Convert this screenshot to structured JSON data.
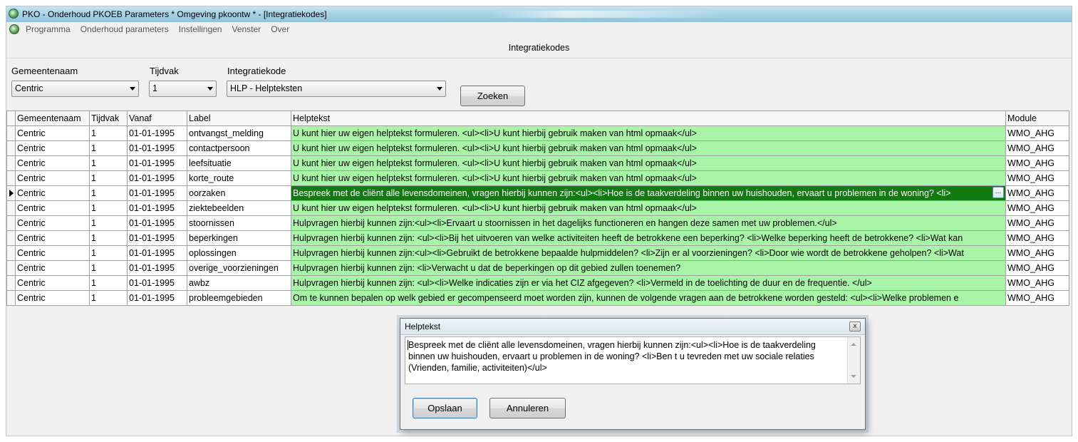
{
  "window": {
    "title": "PKO - Onderhoud PKOEB Parameters * Omgeving pkoontw * - [Integratiekodes]",
    "app_icon": "app-globe-icon"
  },
  "menu": {
    "items": [
      "Programma",
      "Onderhoud parameters",
      "Instellingen",
      "Venster",
      "Over"
    ]
  },
  "page": {
    "title": "Integratiekodes"
  },
  "filters": {
    "gemeente_label": "Gemeentenaam",
    "gemeente_value": "Centric",
    "tijdvak_label": "Tijdvak",
    "tijdvak_value": "1",
    "integratiekode_label": "Integratiekode",
    "integratiekode_value": "HLP - Helpteksten",
    "search_label": "Zoeken"
  },
  "grid": {
    "columns": [
      "Gemeentenaam",
      "Tijdvak",
      "Vanaf",
      "Label",
      "Helptekst",
      "Module"
    ],
    "selected_index": 4,
    "rows": [
      [
        "Centric",
        "1",
        "01-01-1995",
        "ontvangst_melding",
        "U kunt hier uw eigen helptekst formuleren. <ul><li>U kunt hierbij gebruik maken van html opmaak</ul>",
        "WMO_AHG"
      ],
      [
        "Centric",
        "1",
        "01-01-1995",
        "contactpersoon",
        "U kunt hier uw eigen helptekst formuleren. <ul><li>U kunt hierbij gebruik maken van html opmaak</ul>",
        "WMO_AHG"
      ],
      [
        "Centric",
        "1",
        "01-01-1995",
        "leefsituatie",
        "U kunt hier uw eigen helptekst formuleren. <ul><li>U kunt hierbij gebruik maken van html opmaak</ul>",
        "WMO_AHG"
      ],
      [
        "Centric",
        "1",
        "01-01-1995",
        "korte_route",
        "U kunt hier uw eigen helptekst formuleren. <ul><li>U kunt hierbij gebruik maken van html opmaak</ul>",
        "WMO_AHG"
      ],
      [
        "Centric",
        "1",
        "01-01-1995",
        "oorzaken",
        "Bespreek met de cliënt alle levensdomeinen, vragen hierbij kunnen zijn:<ul><li>Hoe is de taakverdeling binnen uw huishouden, ervaart u problemen in de woning? <li>",
        "WMO_AHG"
      ],
      [
        "Centric",
        "1",
        "01-01-1995",
        "ziektebeelden",
        "U kunt hier uw eigen helptekst formuleren. <ul><li>U kunt hierbij gebruik maken van html opmaak</ul>",
        "WMO_AHG"
      ],
      [
        "Centric",
        "1",
        "01-01-1995",
        "stoornissen",
        "Hulpvragen hierbij kunnen zijn:<ul><li>Ervaart u stoornissen in het dagelijks functioneren en hangen deze samen met uw problemen.</ul>",
        "WMO_AHG"
      ],
      [
        "Centric",
        "1",
        "01-01-1995",
        "beperkingen",
        "Hulpvragen hierbij kunnen zijn: <ul><li>Bij het uitvoeren van welke activiteiten heeft de betrokkene een beperking? <li>Welke beperking heeft de betrokkene? <li>Wat kan",
        "WMO_AHG"
      ],
      [
        "Centric",
        "1",
        "01-01-1995",
        "oplossingen",
        "Hulpvragen hierbij kunnen zijn:<ul><li>Gebruikt de betrokkene bepaalde hulpmiddelen? <li>Zijn er al voorzieningen? <li>Door wie wordt de betrokkene geholpen? <li>Wat",
        "WMO_AHG"
      ],
      [
        "Centric",
        "1",
        "01-01-1995",
        "overige_voorzieningen",
        "Hulpvragen hierbij kunnen zijn: <li>Verwacht u dat de beperkingen op dit gebied zullen toenemen?",
        "WMO_AHG"
      ],
      [
        "Centric",
        "1",
        "01-01-1995",
        "awbz",
        "Hulpvragen hierbij kunnen zijn: <ul><li>Welke indicaties zijn er via het CIZ afgegeven?  <li>Vermeld in de toelichting de duur en de frequentie. </ul>",
        "WMO_AHG"
      ],
      [
        "Centric",
        "1",
        "01-01-1995",
        "probleemgebieden",
        "Om te kunnen bepalen op welk gebied er gecompenseerd moet worden  zijn, kunnen de volgende vragen aan de betrokkene worden gesteld: <ul><li>Welke problemen e",
        "WMO_AHG"
      ]
    ]
  },
  "dialog": {
    "title": "Helptekst",
    "text": "Bespreek met de cliënt alle levensdomeinen, vragen hierbij kunnen zijn:<ul><li>Hoe is de taakverdeling binnen uw huishouden, ervaart u problemen in de woning? <li>Ben t u tevreden met uw sociale relaties (Vrienden, familie, activiteiten)</ul>",
    "save_label": "Opslaan",
    "cancel_label": "Annuleren",
    "close_glyph": "x"
  },
  "colors": {
    "help_cell_bg": "#a8f5a8",
    "selected_cell_bg": "#117a11"
  }
}
